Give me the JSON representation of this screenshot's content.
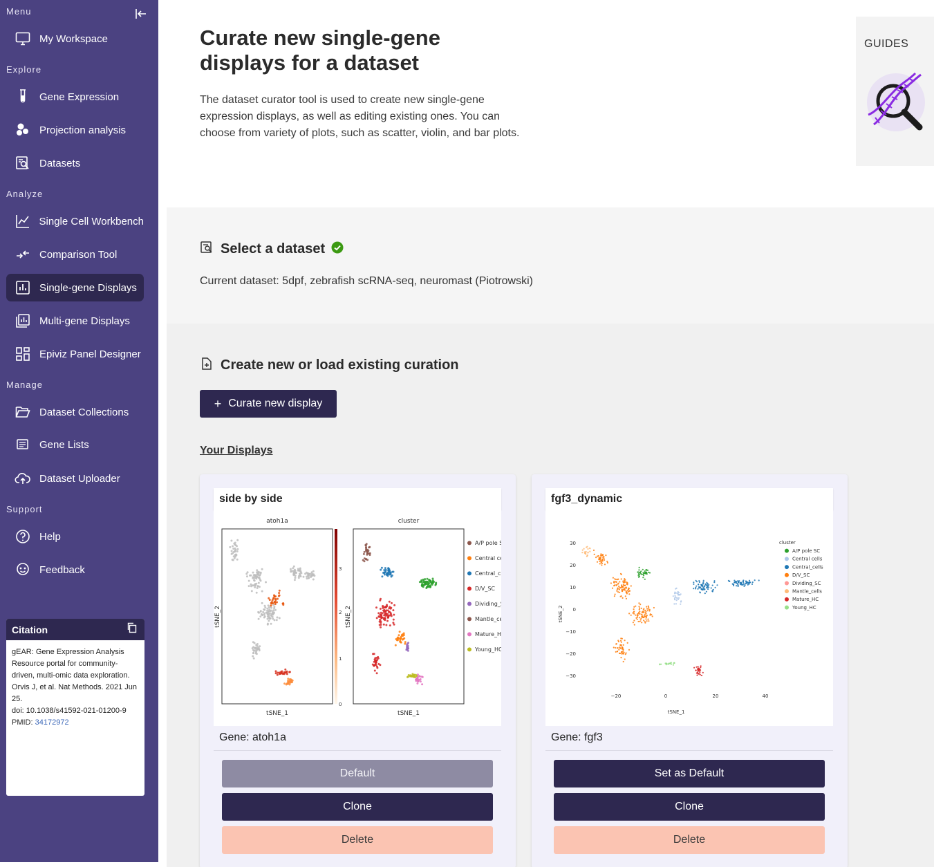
{
  "sidebar": {
    "sections": {
      "menu": "Menu",
      "explore": "Explore",
      "analyze": "Analyze",
      "manage": "Manage",
      "support": "Support"
    },
    "items": {
      "my_workspace": "My Workspace",
      "gene_expression": "Gene Expression",
      "projection_analysis": "Projection analysis",
      "datasets": "Datasets",
      "single_cell_workbench": "Single Cell Workbench",
      "comparison_tool": "Comparison Tool",
      "single_gene_displays": "Single-gene Displays",
      "multi_gene_displays": "Multi-gene Displays",
      "epiviz_panel_designer": "Epiviz Panel Designer",
      "dataset_collections": "Dataset Collections",
      "gene_lists": "Gene Lists",
      "dataset_uploader": "Dataset Uploader",
      "help": "Help",
      "feedback": "Feedback"
    },
    "active_item": "single_gene_displays",
    "citation": {
      "title": "Citation",
      "line1": "gEAR: Gene Expression Analysis Resource portal for community-driven, multi-omic data exploration.",
      "line2": "Orvis J, et al. Nat Methods. 2021 Jun 25.",
      "line3": "doi: 10.1038/s41592-021-01200-9",
      "pmid_label": "PMID:",
      "pmid": "34172972"
    }
  },
  "header": {
    "title": "Curate new single-gene displays for a dataset",
    "description": "The dataset curator tool is used to create new single-gene expression displays, as well as editing existing ones. You can choose from variety of plots, such as scatter, violin, and bar plots."
  },
  "guides": {
    "title": "GUIDES"
  },
  "select_dataset": {
    "heading": "Select a dataset",
    "current_label": "Current dataset: 5dpf, zebrafish scRNA-seq, neuromast (Piotrowski)"
  },
  "curation": {
    "heading": "Create new or load existing curation",
    "new_button": "Curate new display",
    "your_displays": "Your Displays"
  },
  "cards": [
    {
      "title": "side by side",
      "gene": "Gene: atoh1a",
      "default_label": "Default",
      "clone_label": "Clone",
      "delete_label": "Delete",
      "plot": {
        "left_title": "atoh1a",
        "right_title": "cluster",
        "xlabel": "tSNE_1",
        "ylabel": "tSNE_2",
        "colorbar_ticks": [
          "3",
          "2",
          "1",
          "0"
        ],
        "legend": [
          "A/P pole SC",
          "Central cells",
          "Central_cells",
          "D/V_SC",
          "Dividing_SC",
          "Mantle_cells",
          "Mature_HC",
          "Young_HC"
        ]
      }
    },
    {
      "title": "fgf3_dynamic",
      "gene": "Gene: fgf3",
      "default_label": "Set as Default",
      "clone_label": "Clone",
      "delete_label": "Delete",
      "plot": {
        "legend_title": "cluster",
        "legend": [
          "A/P pole SC",
          "Central cells",
          "Central_cells",
          "D/V_SC",
          "Dividing_SC",
          "Mantle_cells",
          "Mature_HC",
          "Young_HC"
        ],
        "x_ticks": [
          "−20",
          "0",
          "20",
          "40"
        ],
        "y_ticks": [
          "30",
          "20",
          "10",
          "0",
          "−10",
          "−20",
          "−30"
        ],
        "xlabel": "tSNE_1",
        "ylabel": "tSNE_2"
      }
    }
  ],
  "colors": {
    "sidebar_bg": "#4b4281",
    "primary": "#2e2850",
    "danger": "#fbc4b2",
    "disabled": "#8e8ba3",
    "success": "#3c9a12",
    "clusters": [
      "#2ca02c",
      "#aec7e8",
      "#1f77b4",
      "#ff7f0e",
      "#ff9896",
      "#ffbb78",
      "#d62728",
      "#98df8a"
    ],
    "clusters_left": [
      "#8c564b",
      "#ff7f0e",
      "#1f77b4",
      "#d62728",
      "#9467bd",
      "#8c564b",
      "#e377c2",
      "#bcbd22"
    ]
  }
}
